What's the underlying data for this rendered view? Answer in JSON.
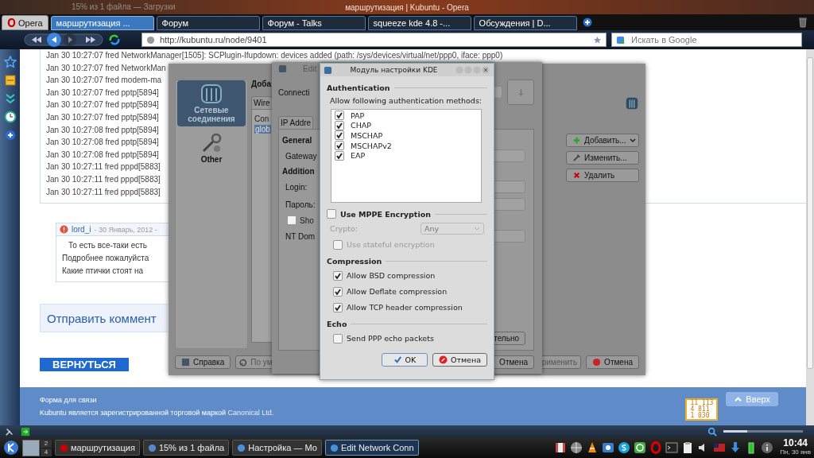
{
  "window": {
    "title": "маршрутизация | Kubuntu - Opera",
    "background_title": "15% из 1 файла — Загрузки"
  },
  "browser": {
    "menu_button": "Opera",
    "tabs": [
      {
        "label": "маршрутизация ...",
        "selected": true
      },
      {
        "label": "Форум",
        "selected": false
      },
      {
        "label": "Форум - Talks",
        "selected": false
      },
      {
        "label": "squeeze kde 4.8 -...",
        "selected": false
      },
      {
        "label": "Обсуждения | D...",
        "selected": false
      }
    ],
    "address": "http://kubuntu.ru/node/9401",
    "search_placeholder": "Искать в Google"
  },
  "page": {
    "log_lines": [
      "Jan 30 10:27:07 fred NetworkManager[1505]: SCPlugin-Ifupdown: devices added (path: /sys/devices/virtual/net/ppp0, iface: ppp0)",
      "Jan 30 10:27:07 fred NetworkMan",
      "Jan 30 10:27:07 fred modem-ma",
      "Jan 30 10:27:07 fred pptp[5894]",
      "Jan 30 10:27:07 fred pptp[5894]",
      "Jan 30 10:27:07 fred pptp[5894]",
      "Jan 30 10:27:08 fred pptp[5894]",
      "Jan 30 10:27:08 fred pptp[5894]",
      "Jan 30 10:27:08 fred pptp[5894]",
      "Jan 30 10:27:11 fred pppd[5883]",
      "Jan 30 10:27:11 fred pppd[5883]",
      "Jan 30 10:27:11 fred pppd[5883]"
    ],
    "comment": {
      "author": "lord_i",
      "date": "- 30 Январь, 2012 -",
      "lines": [
        "То есть все-таки есть",
        "Подробнее пожалуйста",
        "Какие птички стоят на"
      ]
    },
    "reply_heading": "Отправить коммент",
    "back_banner": "ВЕРНУТЬСЯ",
    "footer": {
      "contact": "Форма для связи",
      "trademark": "Kubuntu является зарегистрированной торговой маркой",
      "trademark_link": "Canonical Ltd.",
      "top_button": "Вверх",
      "counter_lines": [
        "11 113",
        "4 811",
        "1 030"
      ]
    }
  },
  "settings_window": {
    "sidebar": [
      {
        "label": "Сетевые соединения",
        "selected": true
      },
      {
        "label": "Other",
        "selected": false
      }
    ],
    "heading": "Доба",
    "tab": "Wire",
    "list_header": "Con",
    "list_row": "glob",
    "actions": [
      "Добавить...",
      "Изменить...",
      "Удалить"
    ],
    "help_button": "Справка",
    "defaults_button": "По ум",
    "apply_button": "рименить",
    "cancel_button": "Отмена"
  },
  "edit_window": {
    "title": "Edit",
    "connection_label": "Connecti",
    "tab": "IP Addre",
    "general_heading": "General",
    "gateway_label": "Gateway",
    "additional_heading": "Addition",
    "login_label": "Login:",
    "password_label": "Пароль:",
    "show_password": {
      "label": "Sho",
      "checked": false
    },
    "domain_label": "NT Dom",
    "more_button": "тельно",
    "cancel_button": "Отмена"
  },
  "auth_dialog": {
    "title": "Модуль настройки KDE",
    "auth_heading": "Authentication",
    "methods_label": "Allow following authentication methods:",
    "methods": [
      {
        "label": "PAP",
        "checked": true
      },
      {
        "label": "CHAP",
        "checked": true
      },
      {
        "label": "MSCHAP",
        "checked": true
      },
      {
        "label": "MSCHAPv2",
        "checked": true
      },
      {
        "label": "EAP",
        "checked": true
      }
    ],
    "mppe": {
      "label": "Use MPPE Encryption",
      "checked": false
    },
    "crypto_label": "Crypto:",
    "crypto_value": "Any",
    "stateful": {
      "label": "Use stateful encryption",
      "checked": false,
      "disabled": true
    },
    "compression_heading": "Compression",
    "compression": [
      {
        "label": "Allow BSD compression",
        "checked": true
      },
      {
        "label": "Allow Deflate compression",
        "checked": true
      },
      {
        "label": "Allow TCP header compression",
        "checked": true
      }
    ],
    "echo_heading": "Echo",
    "echo": {
      "label": "Send PPP echo packets",
      "checked": false
    },
    "ok_button": "OK",
    "cancel_button": "Отмена"
  },
  "status_bar": {
    "zoom": {
      "level": 0.3
    }
  },
  "taskbar": {
    "tasks": [
      {
        "label": "маршрутизация",
        "selected": false
      },
      {
        "label": "15% из 1 файла",
        "selected": false
      },
      {
        "label": "Настройка — Мо",
        "selected": false
      },
      {
        "label": "Edit Network Conn",
        "selected": true
      }
    ],
    "pager": [
      "2",
      "4"
    ],
    "clock": "10:44",
    "date": "Пн, 30 янв"
  }
}
